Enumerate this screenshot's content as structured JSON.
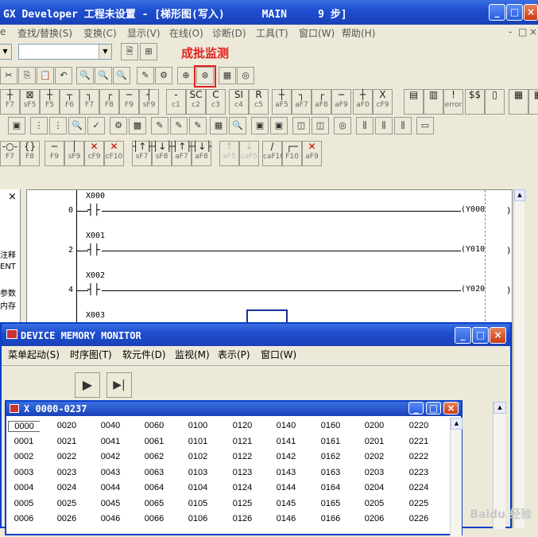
{
  "window": {
    "title": "GX Developer 工程未设置 - [梯形图(写入)      MAIN     9 步]",
    "controls": {
      "minimize": "_",
      "maximize": "□",
      "close": "×"
    }
  },
  "menu": {
    "items": [
      "查找/替换(S)",
      "变换(C)",
      "显示(V)",
      "在线(O)",
      "诊断(D)",
      "工具(T)",
      "窗口(W)",
      "帮助(H)"
    ],
    "left_cut": "e",
    "right_controls": {
      "min": "-",
      "restore": "□",
      "close": "×"
    }
  },
  "annotation": "成批监测",
  "toolbar_function_keys": {
    "row1": [
      "F7",
      "sF5",
      "F5",
      "F6",
      "F7",
      "F8",
      "F9",
      "sF9",
      "c1",
      "c2",
      "c3",
      "c4",
      "c5",
      "aF5",
      "aF7",
      "aF8",
      "aF9",
      "aF0",
      "cF9"
    ],
    "row2_extra": [
      "error"
    ],
    "row3": [
      "F7",
      "F8",
      "F9",
      "sF9",
      "cF9",
      "cF10",
      "sF7",
      "sF8",
      "aF7",
      "aF8",
      "aF5",
      "caF5",
      "caF10",
      "F10",
      "aF9"
    ]
  },
  "left_panel": {
    "close": "×",
    "labels": [
      "注释",
      "ENT",
      "参数",
      "内存"
    ]
  },
  "ladder": {
    "rungs": [
      {
        "step": "0",
        "contact": "X000",
        "coil": "Y000"
      },
      {
        "step": "2",
        "contact": "X001",
        "coil": "Y010"
      },
      {
        "step": "4",
        "contact": "X002",
        "coil": "Y020"
      },
      {
        "step": "",
        "contact": "X003",
        "coil": ""
      }
    ]
  },
  "monitor": {
    "title": "DEVICE MEMORY MONITOR",
    "menu": [
      "菜单起动(S)",
      "时序图(T)",
      "软元件(D)",
      "监视(M)",
      "表示(P)",
      "窗口(W)"
    ],
    "play_label": "▶",
    "step_label": "▶|",
    "sub_window": {
      "title": "X   0000-0237",
      "columns": [
        [
          "0000",
          "0001",
          "0002",
          "0003",
          "0004",
          "0005",
          "0006"
        ],
        [
          "0020",
          "0021",
          "0022",
          "0023",
          "0024",
          "0025",
          "0026"
        ],
        [
          "0040",
          "0041",
          "0042",
          "0043",
          "0044",
          "0045",
          "0046"
        ],
        [
          "0060",
          "0061",
          "0062",
          "0063",
          "0064",
          "0065",
          "0066"
        ],
        [
          "0100",
          "0101",
          "0102",
          "0103",
          "0104",
          "0105",
          "0106"
        ],
        [
          "0120",
          "0121",
          "0122",
          "0123",
          "0124",
          "0125",
          "0126"
        ],
        [
          "0140",
          "0141",
          "0142",
          "0143",
          "0144",
          "0145",
          "0146"
        ],
        [
          "0160",
          "0161",
          "0162",
          "0163",
          "0164",
          "0165",
          "0166"
        ],
        [
          "0200",
          "0201",
          "0202",
          "0203",
          "0204",
          "0205",
          "0206"
        ],
        [
          "0220",
          "0221",
          "0222",
          "0223",
          "0224",
          "0225",
          "0226"
        ]
      ]
    }
  },
  "watermark": "Baidu 经验"
}
